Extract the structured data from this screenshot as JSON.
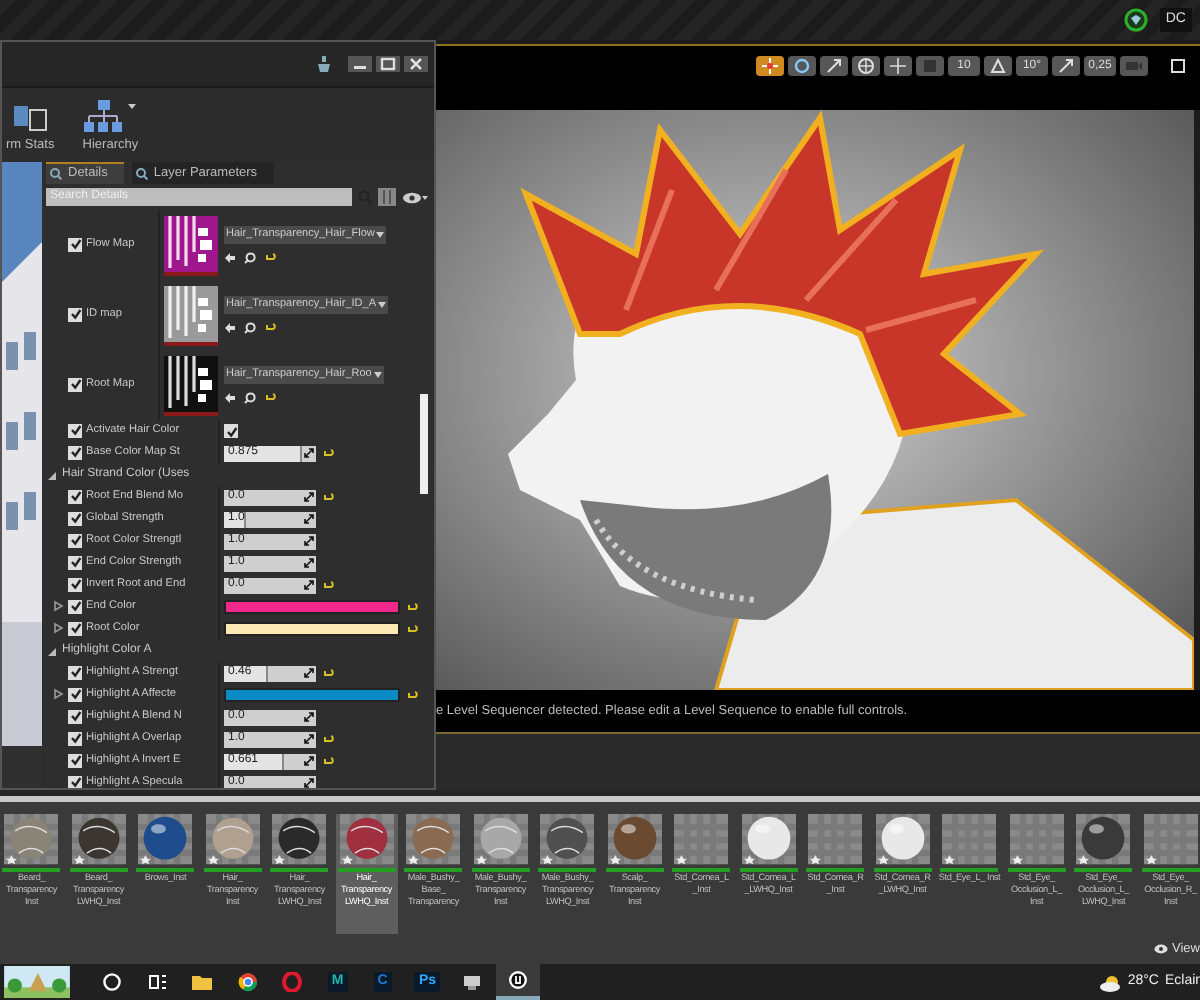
{
  "top_bar": {
    "label": "DC"
  },
  "details_window": {
    "toolbar": [
      {
        "label": "rm Stats",
        "dropdown": false
      },
      {
        "label": "Hierarchy",
        "dropdown": true
      }
    ],
    "tabs": [
      {
        "label": "Details",
        "selected": true
      },
      {
        "label": "Layer Parameters",
        "selected": false
      }
    ],
    "search": {
      "placeholder": "Search Details"
    },
    "properties": [
      {
        "kind": "texture",
        "label": "Flow Map",
        "enabled": true,
        "asset": "Hair_Transparency_Hair_Flow",
        "color": "#a0168c"
      },
      {
        "kind": "texture",
        "label": "ID map",
        "enabled": true,
        "asset": "Hair_Transparency_Hair_ID_A",
        "color": "#9a9a9a"
      },
      {
        "kind": "texture",
        "label": "Root Map",
        "enabled": true,
        "asset": "Hair_Transparency_Hair_Roo",
        "color": "#101010"
      },
      {
        "kind": "toggle",
        "label": "Activate Hair Color",
        "enabled": true,
        "checked": true,
        "reset": false
      },
      {
        "kind": "number",
        "label": "Base Color Map St",
        "enabled": true,
        "value": "0.875",
        "level": 0.85,
        "reset": true
      },
      {
        "kind": "group",
        "label": "Hair Strand Color (Uses",
        "expanded": true
      },
      {
        "kind": "number",
        "label": "Root End Blend Mo",
        "enabled": true,
        "value": "0.0",
        "reset": true
      },
      {
        "kind": "number",
        "label": "Global Strength",
        "enabled": true,
        "value": "1.0",
        "level": 0.23,
        "reset": false
      },
      {
        "kind": "number",
        "label": "Root Color Strengtl",
        "enabled": true,
        "value": "1.0",
        "reset": false
      },
      {
        "kind": "number",
        "label": "End Color Strength",
        "enabled": true,
        "value": "1.0",
        "reset": false
      },
      {
        "kind": "number",
        "label": "Invert Root and End",
        "enabled": true,
        "value": "0.0",
        "reset": true
      },
      {
        "kind": "color",
        "label": "End Color",
        "enabled": true,
        "expanded": false,
        "color": "#f0288c",
        "reset": true
      },
      {
        "kind": "color",
        "label": "Root Color",
        "enabled": true,
        "expanded": false,
        "color": "#fde9b4",
        "reset": true
      },
      {
        "kind": "group",
        "label": "Highlight Color A",
        "expanded": true
      },
      {
        "kind": "number",
        "label": "Highlight A Strengt",
        "enabled": true,
        "value": "0.46",
        "level": 0.47,
        "reset": true
      },
      {
        "kind": "color",
        "label": "Highlight A Affecte",
        "enabled": true,
        "expanded": false,
        "color": "#0a8ac4",
        "reset": true
      },
      {
        "kind": "number",
        "label": "Highlight A Blend N",
        "enabled": true,
        "value": "0.0",
        "reset": false
      },
      {
        "kind": "number",
        "label": "Highlight A Overlap",
        "enabled": true,
        "value": "1.0",
        "reset": true
      },
      {
        "kind": "number",
        "label": "Highlight A Invert E",
        "enabled": true,
        "value": "0.661",
        "level": 0.65,
        "reset": true
      },
      {
        "kind": "number",
        "label": "Highlight A Specula",
        "enabled": true,
        "value": "0.0",
        "reset": false
      }
    ]
  },
  "viewport": {
    "toolbar": [
      {
        "kind": "move",
        "selected": true
      },
      {
        "kind": "rotate",
        "selected": false
      },
      {
        "kind": "scale",
        "selected": false
      },
      {
        "kind": "globe",
        "selected": false
      },
      {
        "kind": "snap",
        "selected": false
      },
      {
        "kind": "grid",
        "selected": false
      },
      {
        "kind": "value",
        "label": "10",
        "selected": false
      },
      {
        "kind": "angle",
        "selected": false
      },
      {
        "kind": "value",
        "label": "10°",
        "selected": false
      },
      {
        "kind": "resize",
        "selected": false
      },
      {
        "kind": "value",
        "label": "0,25",
        "selected": false
      },
      {
        "kind": "camera",
        "selected": false
      },
      {
        "kind": "maximize",
        "selected": false
      }
    ],
    "message": "e Level Sequencer detected. Please edit a Level Sequence to enable full controls."
  },
  "content_browser": {
    "assets": [
      {
        "label": "Beard_ Transparency Inst",
        "kind": "fur",
        "color": "#8a8478",
        "selected": false
      },
      {
        "label": "Beard_ Transparency LWHQ_Inst",
        "kind": "fur",
        "color": "#3c3631",
        "selected": false
      },
      {
        "label": "Brows_Inst",
        "kind": "sphere",
        "color": "#1e4c8c",
        "selected": false
      },
      {
        "label": "Hair_ Transparency Inst",
        "kind": "fur",
        "color": "#b0a090",
        "selected": false
      },
      {
        "label": "Hair_ Transparency LWHQ_Inst",
        "kind": "fur",
        "color": "#2a2a2a",
        "selected": false
      },
      {
        "label": "Hair_ Transparency LWHQ_Inst",
        "kind": "fur",
        "color": "#a03040",
        "selected": true
      },
      {
        "label": "Male_Bushy_ Base_ Transparency",
        "kind": "fur",
        "color": "#8a6a50",
        "selected": false
      },
      {
        "label": "Male_Bushy_ Transparency Inst",
        "kind": "fur",
        "color": "#a8a8a8",
        "selected": false
      },
      {
        "label": "Male_Bushy_ Transparency LWHQ_Inst",
        "kind": "fur",
        "color": "#505050",
        "selected": false
      },
      {
        "label": "Scalp_ Transparency Inst",
        "kind": "sphere",
        "color": "#6a4a30",
        "selected": false
      },
      {
        "label": "Std_Cornea_L _Inst",
        "kind": "checker",
        "selected": false
      },
      {
        "label": "Std_Cornea_L _LWHQ_Inst",
        "kind": "sphere",
        "color": "#e8e8e8",
        "selected": false
      },
      {
        "label": "Std_Cornea_R _Inst",
        "kind": "checker",
        "selected": false
      },
      {
        "label": "Std_Cornea_R _LWHQ_Inst",
        "kind": "sphere",
        "color": "#e8e8e8",
        "selected": false
      },
      {
        "label": "Std_Eye_L_ Inst",
        "kind": "checker",
        "selected": false
      },
      {
        "label": "Std_Eye_ Occlusion_L_ Inst",
        "kind": "checker",
        "selected": false
      },
      {
        "label": "Std_Eye_ Occlusion_L_ LWHQ_Inst",
        "kind": "sphere",
        "color": "#3a3a3a",
        "selected": false
      },
      {
        "label": "Std_Eye_ Occlusion_R_ Inst",
        "kind": "checker",
        "selected": false
      }
    ],
    "view_label": "View"
  },
  "taskbar": {
    "apps": [
      {
        "kind": "widget",
        "selected": false
      },
      {
        "kind": "search",
        "selected": false
      },
      {
        "kind": "taskview",
        "selected": false
      },
      {
        "kind": "folder",
        "selected": false
      },
      {
        "kind": "chrome",
        "selected": false
      },
      {
        "kind": "opera",
        "selected": false
      },
      {
        "kind": "letter",
        "label": "M",
        "color": "#1fb8a8",
        "selected": false
      },
      {
        "kind": "letter",
        "label": "C",
        "color": "#1c7cd6",
        "selected": false
      },
      {
        "kind": "letter",
        "label": "Ps",
        "color": "#31a8ff",
        "selected": false
      },
      {
        "kind": "device",
        "selected": false
      },
      {
        "kind": "unreal",
        "selected": true
      }
    ],
    "temperature": "28°C",
    "weather_text": "Eclair"
  }
}
